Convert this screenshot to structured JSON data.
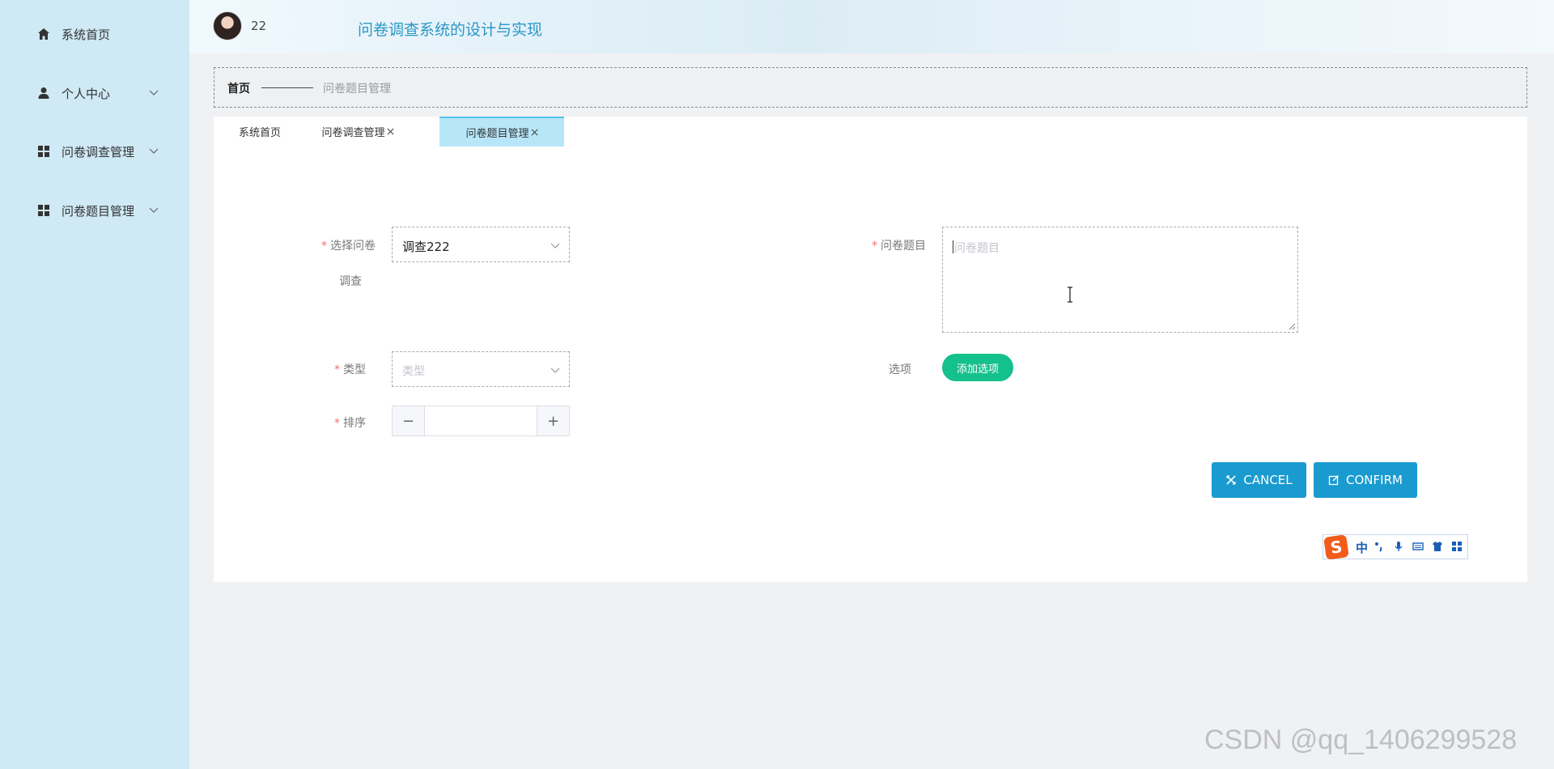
{
  "sidebar": {
    "items": [
      {
        "label": "系统首页",
        "icon": "home-icon"
      },
      {
        "label": "个人中心",
        "icon": "user-icon"
      },
      {
        "label": "问卷调查管理",
        "icon": "grid-icon"
      },
      {
        "label": "问卷题目管理",
        "icon": "grid-icon"
      }
    ]
  },
  "header": {
    "username": "22",
    "title": "问卷调查系统的设计与实现"
  },
  "breadcrumb": {
    "home": "首页",
    "current": "问卷题目管理"
  },
  "tabs": [
    {
      "label": "系统首页",
      "closable": false,
      "active": false
    },
    {
      "label": "问卷调查管理",
      "closable": true,
      "active": false
    },
    {
      "label": "问卷题目管理",
      "closable": true,
      "active": true
    }
  ],
  "form": {
    "survey": {
      "label_line1": "选择问卷",
      "label_line2": "调查",
      "value": "调查222"
    },
    "question": {
      "label": "问卷题目",
      "placeholder": "问卷题目",
      "value": ""
    },
    "type": {
      "label": "类型",
      "placeholder": "类型"
    },
    "options": {
      "label": "选项",
      "add_button": "添加选项"
    },
    "order": {
      "label": "排序",
      "value": "",
      "minus": "−",
      "plus": "+"
    }
  },
  "actions": {
    "cancel": "CANCEL",
    "confirm": "CONFIRM"
  },
  "ime": {
    "logo": "S",
    "mode": "中"
  },
  "watermark": "CSDN @qq_1406299528",
  "colors": {
    "sidebar_bg": "#cfe9f5",
    "title": "#2a97c6",
    "primary_button": "#1a9bd0",
    "add_button": "#14c08b",
    "active_tab": "#b7e6f9",
    "required": "#f56c6c"
  }
}
